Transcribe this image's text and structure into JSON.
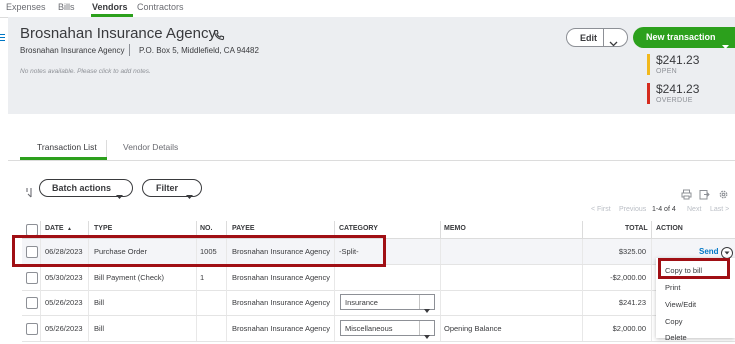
{
  "top_tabs": [
    {
      "label": "Expenses"
    },
    {
      "label": "Bills"
    },
    {
      "label": "Vendors"
    },
    {
      "label": "Contractors"
    }
  ],
  "vendor": {
    "name": "Brosnahan Insurance Agency",
    "company": "Brosnahan Insurance Agency",
    "address": "P.O. Box 5, Middlefield, CA 94482",
    "notes": "No notes available. Please click to add notes."
  },
  "actions": {
    "edit_label": "Edit",
    "new_transaction_label": "New transaction"
  },
  "stats": [
    {
      "amount": "$241.23",
      "caption": "OPEN",
      "color": "#f2b81c"
    },
    {
      "amount": "$241.23",
      "caption": "OVERDUE",
      "color": "#d52b1e"
    }
  ],
  "sub_tabs": [
    {
      "label": "Transaction List"
    },
    {
      "label": "Vendor Details"
    }
  ],
  "toolbar": {
    "batch_actions_label": "Batch actions",
    "filter_label": "Filter"
  },
  "pager": {
    "first": "< First",
    "previous": "Previous",
    "range": "1-4 of 4",
    "next": "Next",
    "last": "Last >"
  },
  "columns": [
    "DATE",
    "TYPE",
    "NO.",
    "PAYEE",
    "CATEGORY",
    "MEMO",
    "TOTAL",
    "ACTION"
  ],
  "date_sort_indicator": "▲",
  "rows": [
    {
      "date": "06/28/2023",
      "type": "Purchase Order",
      "no": "1005",
      "payee": "Brosnahan Insurance Agency",
      "category": "-Split-",
      "category_select": false,
      "memo": "",
      "total": "$325.00",
      "action": "Send"
    },
    {
      "date": "05/30/2023",
      "type": "Bill Payment (Check)",
      "no": "1",
      "payee": "Brosnahan Insurance Agency",
      "category": "",
      "category_select": false,
      "memo": "",
      "total": "-$2,000.00",
      "action": ""
    },
    {
      "date": "05/26/2023",
      "type": "Bill",
      "no": "",
      "payee": "Brosnahan Insurance Agency",
      "category": "Insurance",
      "category_select": true,
      "memo": "",
      "total": "$241.23",
      "action": ""
    },
    {
      "date": "05/26/2023",
      "type": "Bill",
      "no": "",
      "payee": "Brosnahan Insurance Agency",
      "category": "Miscellaneous",
      "category_select": true,
      "memo": "Opening Balance",
      "total": "$2,000.00",
      "action": ""
    }
  ],
  "action_menu": [
    "Copy to bill",
    "Print",
    "View/Edit",
    "Copy",
    "Delete"
  ]
}
